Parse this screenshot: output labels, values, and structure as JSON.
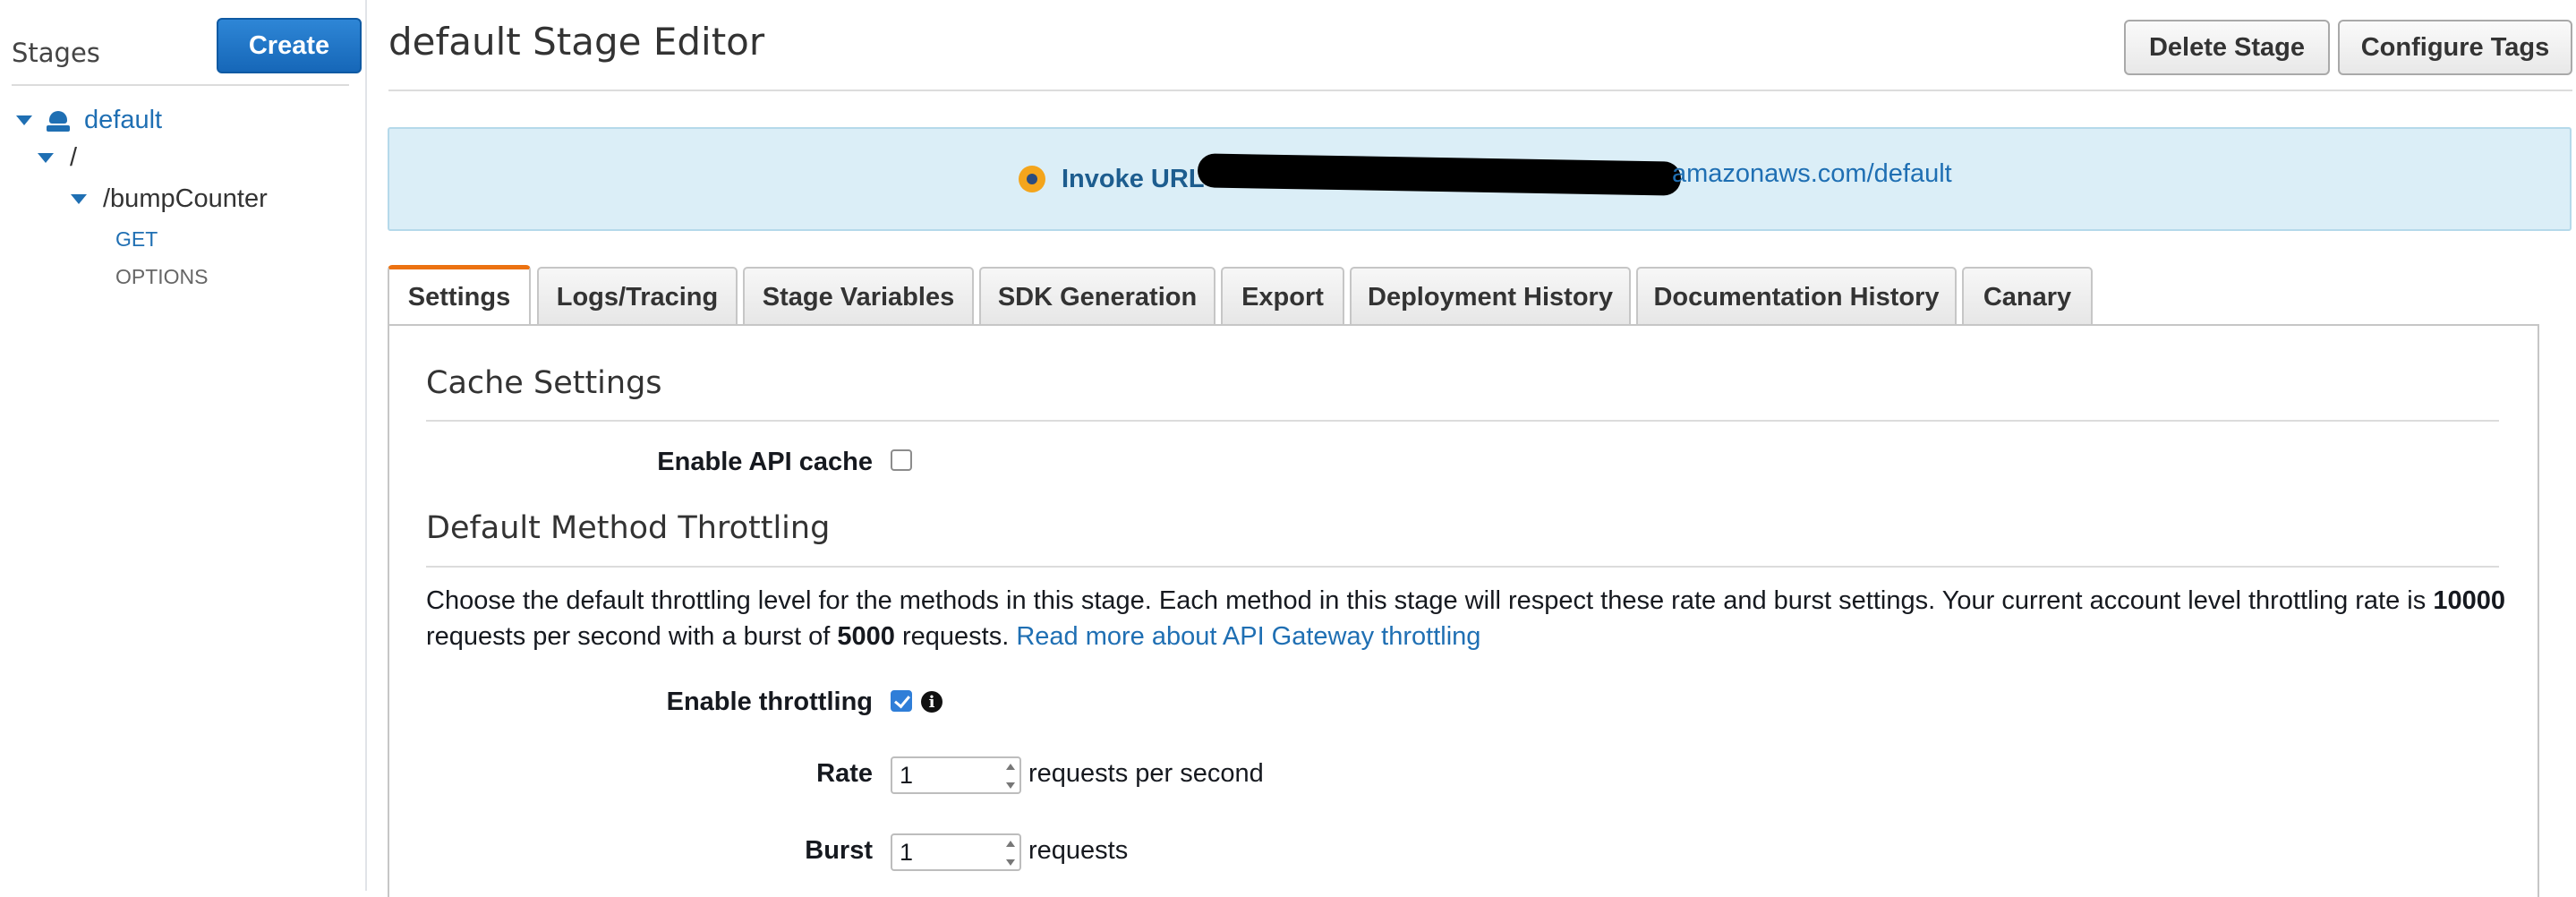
{
  "sidebar": {
    "title": "Stages",
    "create_label": "Create",
    "tree": {
      "stage": "default",
      "root": "/",
      "resource": "/bumpCounter",
      "methods": [
        "GET",
        "OPTIONS"
      ]
    }
  },
  "header": {
    "title": "default Stage Editor",
    "delete_label": "Delete Stage",
    "tags_label": "Configure Tags"
  },
  "invoke": {
    "label": "Invoke URL",
    "url_visible": "amazonaws.com/default"
  },
  "tabs": [
    {
      "label": "Settings",
      "active": true
    },
    {
      "label": "Logs/Tracing"
    },
    {
      "label": "Stage Variables"
    },
    {
      "label": "SDK Generation"
    },
    {
      "label": "Export"
    },
    {
      "label": "Deployment History"
    },
    {
      "label": "Documentation History"
    },
    {
      "label": "Canary"
    }
  ],
  "cache": {
    "title": "Cache Settings",
    "enable_label": "Enable API cache",
    "enabled": false
  },
  "throttling": {
    "title": "Default Method Throttling",
    "desc_part1": "Choose the default throttling level for the methods in this stage. Each method in this stage will respect these rate and burst settings. Your current account level throttling rate is ",
    "rate_limit": "10000",
    "desc_part2": " requests per second with a burst of ",
    "burst_limit": "5000",
    "desc_part3": " requests. ",
    "link": "Read more about API Gateway throttling",
    "enable_label": "Enable throttling",
    "enabled": true,
    "rate_label": "Rate",
    "rate_value": "1",
    "rate_unit": "requests per second",
    "burst_label": "Burst",
    "burst_value": "1",
    "burst_unit": "requests"
  },
  "colors": {
    "accent": "#1f6fb3",
    "tab_active": "#ec7211",
    "invoke_bg": "#dbeef7"
  }
}
